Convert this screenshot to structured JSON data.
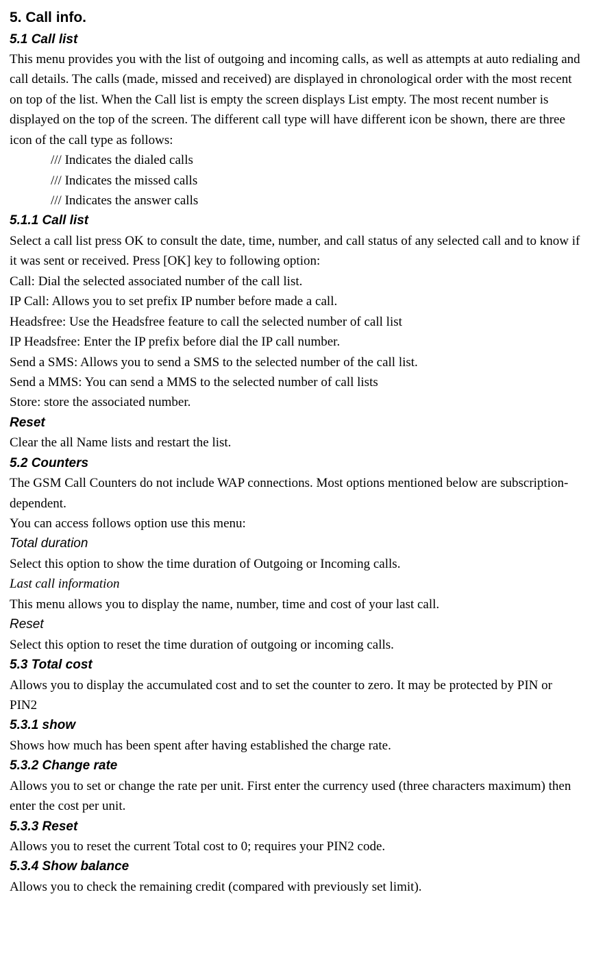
{
  "title": "5. Call info.",
  "s51": {
    "heading": "5.1 Call list",
    "intro": "This menu provides you with the list of outgoing and incoming calls, as well as attempts at auto redialing and call details. The calls (made, missed and received) are displayed in chronological order with the most recent on top of the list. When the Call list is empty the screen displays List empty. The most recent number is displayed on the top of the screen. The different call type will have different icon be shown, there are three icon of the call type as follows:",
    "icons": [
      "/// Indicates the dialed calls",
      "/// Indicates the missed calls",
      "/// Indicates the answer calls"
    ]
  },
  "s511": {
    "heading": "5.1.1 Call list",
    "intro": "Select a call list press OK to consult the date, time, number, and call status of any selected call and to know if it was sent or received. Press [OK] key to following option:",
    "options": [
      "Call: Dial the selected associated number of the call list.",
      "IP Call: Allows you to set prefix IP number before made a call.",
      "Headsfree: Use the Headsfree feature to call the selected number of call list",
      "IP Headsfree: Enter the IP prefix before dial the IP call number.",
      "Send a SMS: Allows you to send a SMS to the selected number of the call list.",
      "Send a MMS: You can send a MMS to the selected number of call lists",
      "Store: store the associated number."
    ],
    "reset_heading": "Reset",
    "reset_body": "Clear the all Name lists and restart the list."
  },
  "s52": {
    "heading": "5.2 Counters",
    "intro1": "The GSM Call Counters do not include WAP connections. Most options mentioned below are subscription-dependent.",
    "intro2": "You can access follows option use this menu:",
    "total_duration_heading": "Total duration",
    "total_duration_body": "Select this option to show the time duration of Outgoing or Incoming calls.",
    "last_call_heading": "Last call information",
    "last_call_body": "This menu allows you to display the name, number, time and cost of your last call.",
    "reset_heading": "Reset",
    "reset_body": "Select this option to reset the time duration of outgoing or incoming calls."
  },
  "s53": {
    "heading": "5.3 Total cost",
    "intro": "Allows you to display the accumulated cost and to set the counter to zero. It may be protected by PIN or PIN2",
    "s531_heading": "5.3.1 show",
    "s531_body": "Shows how much has been spent after having established the charge rate.",
    "s532_heading": "5.3.2 Change rate",
    "s532_body": "Allows you to set or change the rate per unit. First enter the currency used (three characters maximum) then enter the cost per unit.",
    "s533_heading": "5.3.3 Reset",
    "s533_body": "Allows you to reset the current Total cost to 0; requires your PIN2 code.",
    "s534_heading": "5.3.4 Show balance",
    "s534_body": "Allows you to check the remaining credit (compared with previously set limit)."
  }
}
